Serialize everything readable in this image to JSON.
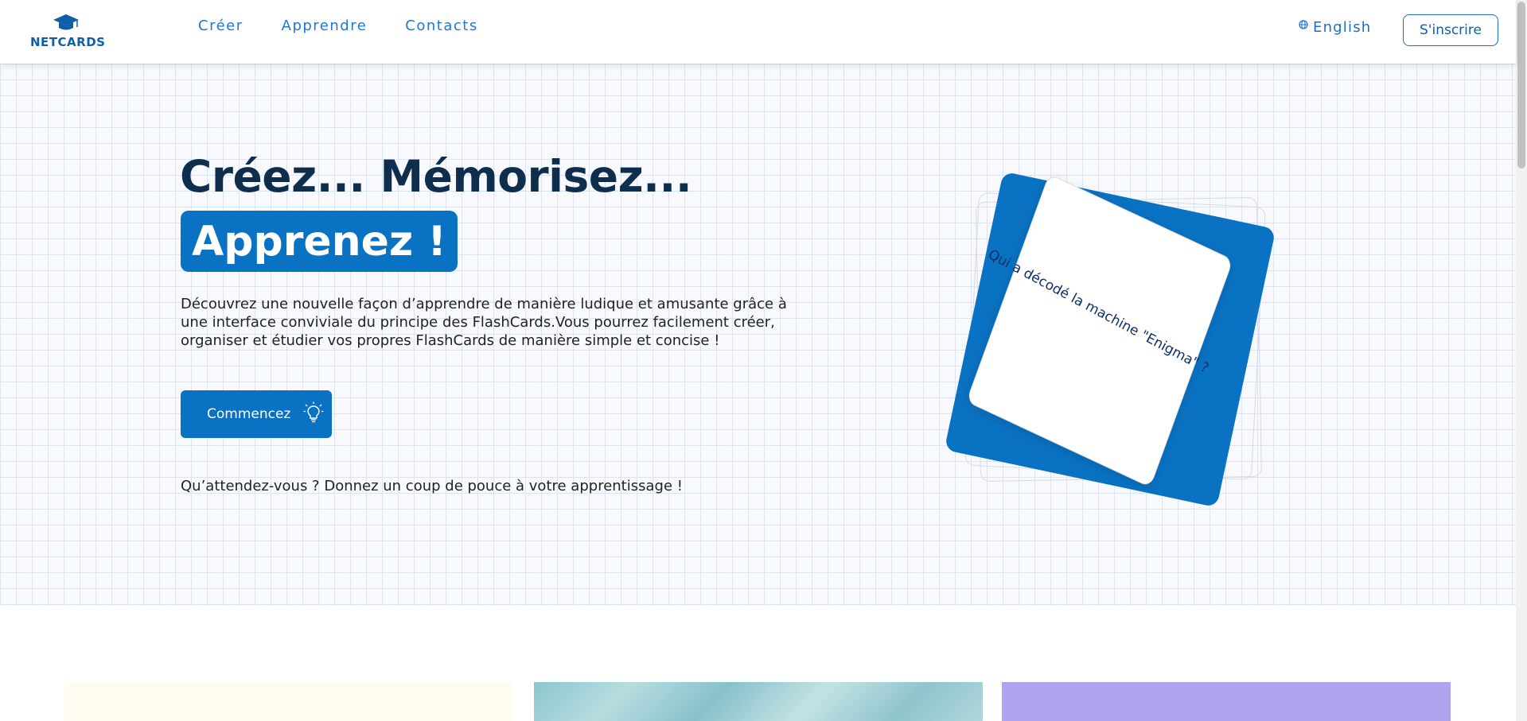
{
  "header": {
    "logo_text": "NETCARDS",
    "nav": [
      {
        "label": "Créer"
      },
      {
        "label": "Apprendre"
      },
      {
        "label": "Contacts"
      }
    ],
    "language": "English",
    "signup_label": "S'inscrire"
  },
  "hero": {
    "title_line1": "Créez... Mémorisez...",
    "title_highlight": "Apprenez !",
    "description": "Découvrez une nouvelle façon d’apprendre de manière ludique et amusante grâce à une interface conviviale du principe des FlashCards.Vous pourrez facilement créer, organiser et étudier vos propres FlashCards de manière simple et concise !",
    "cta_label": "Commencez",
    "tagline": "Qu’attendez-vous ? Donnez un coup de pouce à votre apprentissage !",
    "card_question": "Qui a décodé la machine \"Enigma\" ?"
  },
  "icons": {
    "logo": "graduation-cap-icon",
    "language": "globe-icon",
    "cta": "lightbulb-icon"
  },
  "colors": {
    "primary": "#0a72c2",
    "title": "#0f2e4e",
    "nav": "#1a7ad9",
    "feature_1": "#fffdf0",
    "feature_2": "#8cc6cf",
    "feature_3": "#b0a3ef"
  }
}
